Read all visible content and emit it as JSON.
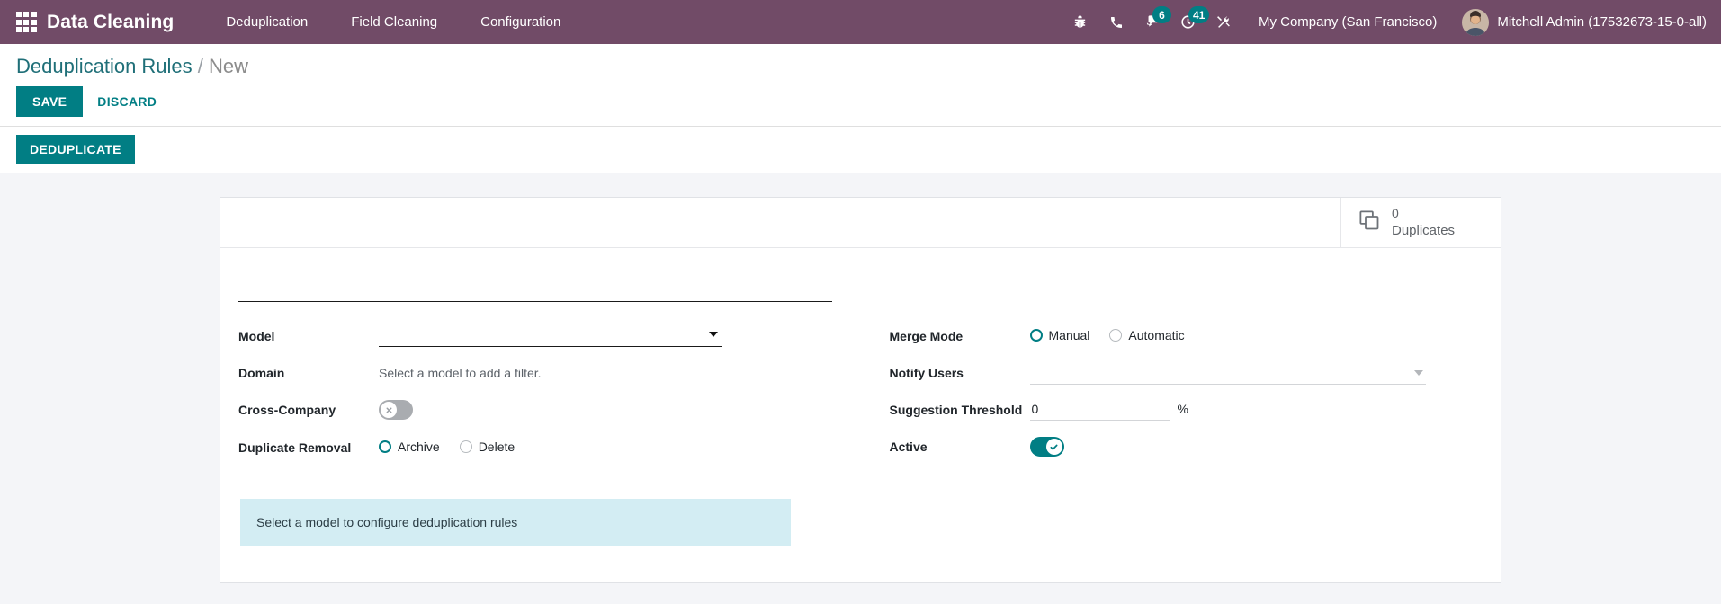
{
  "navbar": {
    "apps_icon": "apps-grid-icon",
    "brand": "Data Cleaning",
    "menu": [
      {
        "label": "Deduplication"
      },
      {
        "label": "Field Cleaning"
      },
      {
        "label": "Configuration"
      }
    ],
    "sys_icons": [
      {
        "name": "bug-icon",
        "badge": null
      },
      {
        "name": "phone-icon",
        "badge": null
      },
      {
        "name": "messages-icon",
        "badge": "6"
      },
      {
        "name": "activities-clock-icon",
        "badge": "41"
      },
      {
        "name": "tools-icon",
        "badge": null
      }
    ],
    "company": "My Company (San Francisco)",
    "user": "Mitchell Admin (17532673-15-0-all)",
    "avatar": "user-avatar"
  },
  "control_panel": {
    "breadcrumb_root": "Deduplication Rules",
    "breadcrumb_separator": "/",
    "breadcrumb_current": "New",
    "save_label": "SAVE",
    "discard_label": "DISCARD"
  },
  "action_row": {
    "deduplicate_label": "DEDUPLICATE"
  },
  "stat_button": {
    "icon": "duplicate-copy-icon",
    "value": "0",
    "label": "Duplicates"
  },
  "form": {
    "title_value": "",
    "title_placeholder": "",
    "left": {
      "model": {
        "label": "Model",
        "value": ""
      },
      "domain": {
        "label": "Domain",
        "value": "Select a model to add a filter."
      },
      "cross_company": {
        "label": "Cross-Company",
        "state": "off"
      },
      "duplicate_removal": {
        "label": "Duplicate Removal",
        "options": [
          {
            "label": "Archive",
            "selected": true
          },
          {
            "label": "Delete",
            "selected": false
          }
        ]
      }
    },
    "right": {
      "merge_mode": {
        "label": "Merge Mode",
        "options": [
          {
            "label": "Manual",
            "selected": true
          },
          {
            "label": "Automatic",
            "selected": false
          }
        ]
      },
      "notify_users": {
        "label": "Notify Users",
        "value": ""
      },
      "suggestion_threshold": {
        "label": "Suggestion Threshold",
        "value": "0",
        "suffix": "%"
      },
      "active": {
        "label": "Active",
        "state": "on"
      }
    },
    "alert": "Select a model to configure deduplication rules"
  },
  "colors": {
    "navbar": "#714B67",
    "accent": "#017E84",
    "breadcrumb": "#1F6F78",
    "alert_bg": "#D3EDF3",
    "page_bg": "#F4F5F8"
  }
}
